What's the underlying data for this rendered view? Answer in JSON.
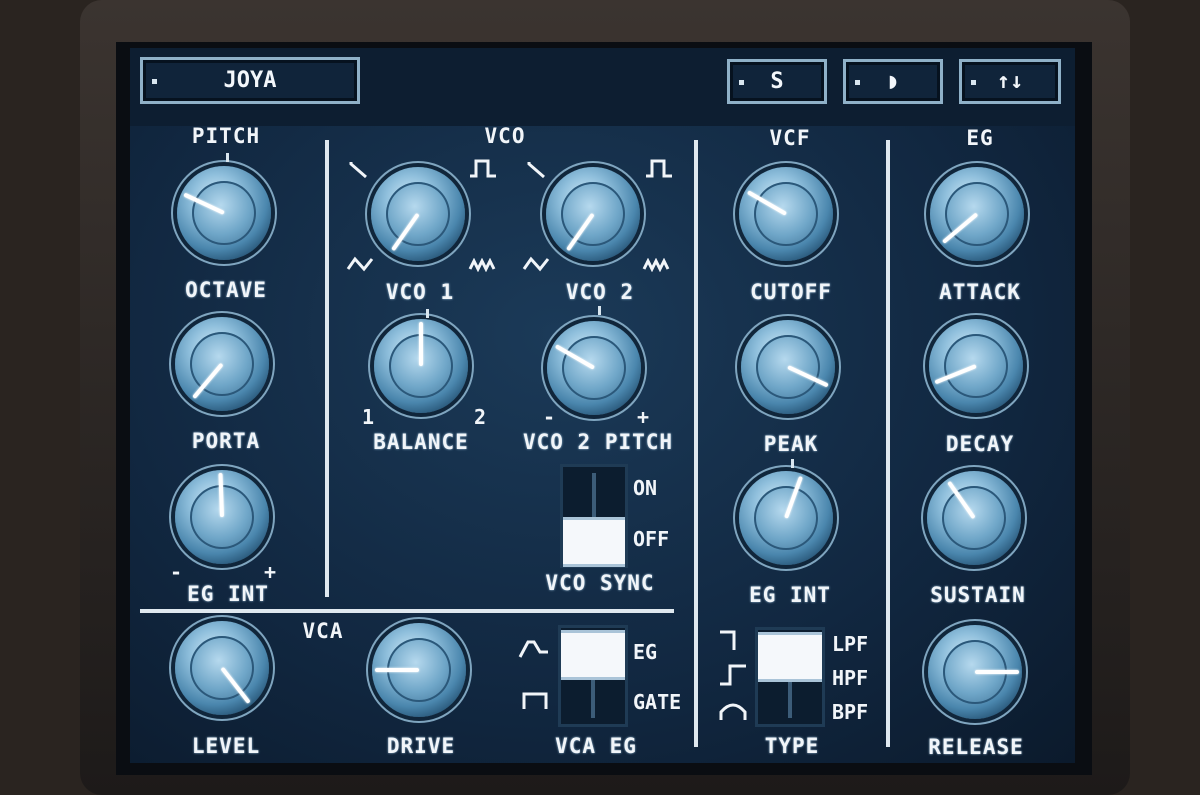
{
  "header": {
    "preset_name": "JOYA",
    "save_label": "S",
    "display_label": "◗",
    "updown_label": "↑↓"
  },
  "sections": {
    "pitch": "PITCH",
    "vco": "VCO",
    "vcf": "VCF",
    "eg": "EG",
    "vca": "VCA"
  },
  "knobs": {
    "octave": "OCTAVE",
    "porta": "PORTA",
    "pitch_eg_int": "EG INT",
    "vco1": "VCO 1",
    "vco2": "VCO 2",
    "balance": "BALANCE",
    "vco2_pitch": "VCO 2 PITCH",
    "cutoff": "CUTOFF",
    "peak": "PEAK",
    "vcf_eg_int": "EG INT",
    "attack": "ATTACK",
    "decay": "DECAY",
    "sustain": "SUSTAIN",
    "release": "RELEASE",
    "level": "LEVEL",
    "drive": "DRIVE"
  },
  "marks": {
    "minus": "-",
    "plus": "+",
    "one": "1",
    "two": "2"
  },
  "switches": {
    "vco_sync": {
      "label": "VCO SYNC",
      "on": "ON",
      "off": "OFF",
      "selected": "OFF"
    },
    "vca_eg": {
      "label": "VCA EG",
      "eg": "EG",
      "gate": "GATE",
      "selected": "EG"
    },
    "type": {
      "label": "TYPE",
      "lpf": "LPF",
      "hpf": "HPF",
      "bpf": "BPF",
      "selected": "LPF"
    }
  },
  "icons": {
    "saw": "saw-wave-icon",
    "square": "square-wave-icon",
    "triangle": "triangle-wave-icon",
    "noise": "noise-wave-icon"
  }
}
